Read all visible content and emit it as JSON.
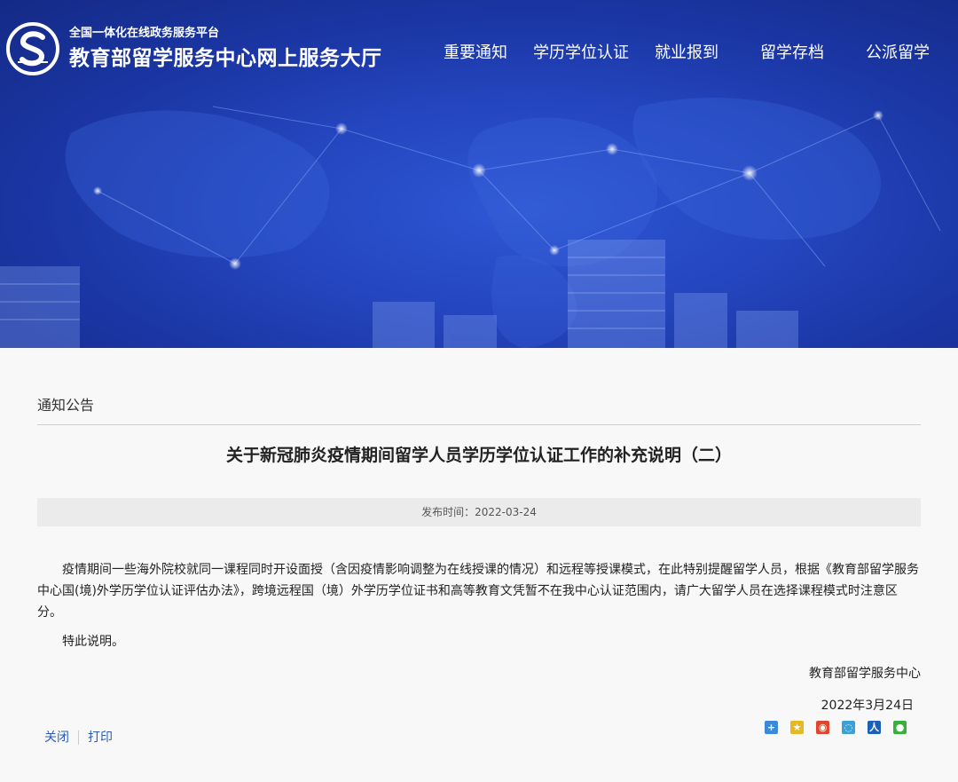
{
  "header": {
    "subtitle": "全国一体化在线政务服务平台",
    "title": "教育部留学服务中心网上服务大厅"
  },
  "nav": {
    "items": [
      {
        "label": "重要通知"
      },
      {
        "label": "学历学位认证"
      },
      {
        "label": "就业报到"
      },
      {
        "label": "留学存档"
      },
      {
        "label": "公派留学"
      }
    ]
  },
  "section": {
    "label": "通知公告"
  },
  "article": {
    "title": "关于新冠肺炎疫情期间留学人员学历学位认证工作的补充说明（二）",
    "publish_time": "发布时间：2022-03-24",
    "paragraph1": "疫情期间一些海外院校就同一课程同时开设面授（含因疫情影响调整为在线授课的情况）和远程等授课模式，在此特别提醒留学人员，根据《教育部留学服务中心国(境)外学历学位认证评估办法》，跨境远程国（境）外学历学位证书和高等教育文凭暂不在我中心认证范围内，请广大留学人员在选择课程模式时注意区分。",
    "paragraph2": "特此说明。",
    "signature_org": "教育部留学服务中心",
    "signature_date": "2022年3月24日"
  },
  "actions": {
    "close_label": "关闭",
    "print_label": "打印"
  },
  "share_icons": [
    {
      "name": "add-share-icon",
      "color": "#3b8ad9"
    },
    {
      "name": "qzone-icon",
      "color": "#e8b820"
    },
    {
      "name": "weibo-icon",
      "color": "#e0452e"
    },
    {
      "name": "tencent-weibo-icon",
      "color": "#3aa0d8"
    },
    {
      "name": "renren-icon",
      "color": "#1b5fb7"
    },
    {
      "name": "wechat-icon",
      "color": "#36b13a"
    }
  ],
  "colors": {
    "hero_blue": "#2446bf",
    "link_blue": "#2a5bb5"
  }
}
